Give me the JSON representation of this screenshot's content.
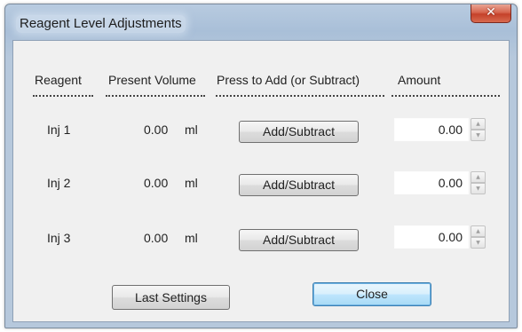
{
  "window": {
    "title": "Reagent Level Adjustments",
    "close_glyph": "✕"
  },
  "headers": {
    "reagent": "Reagent",
    "present_volume": "Present Volume",
    "press_to_add": "Press to Add (or Subtract)",
    "amount": "Amount"
  },
  "rows": [
    {
      "reagent": "Inj 1",
      "volume": "0.00",
      "unit": "ml",
      "button": "Add/Subtract",
      "amount": "0.00"
    },
    {
      "reagent": "Inj 2",
      "volume": "0.00",
      "unit": "ml",
      "button": "Add/Subtract",
      "amount": "0.00"
    },
    {
      "reagent": "Inj 3",
      "volume": "0.00",
      "unit": "ml",
      "button": "Add/Subtract",
      "amount": "0.00"
    }
  ],
  "buttons": {
    "last_settings": "Last Settings",
    "close": "Close"
  },
  "icons": {
    "spin_up": "▲",
    "spin_down": "▼"
  },
  "colors": {
    "title_bar": "#a9bfd8",
    "close_button": "#c5412a",
    "dialog_background": "#f0f0f0",
    "default_button": "#bee6fd"
  }
}
